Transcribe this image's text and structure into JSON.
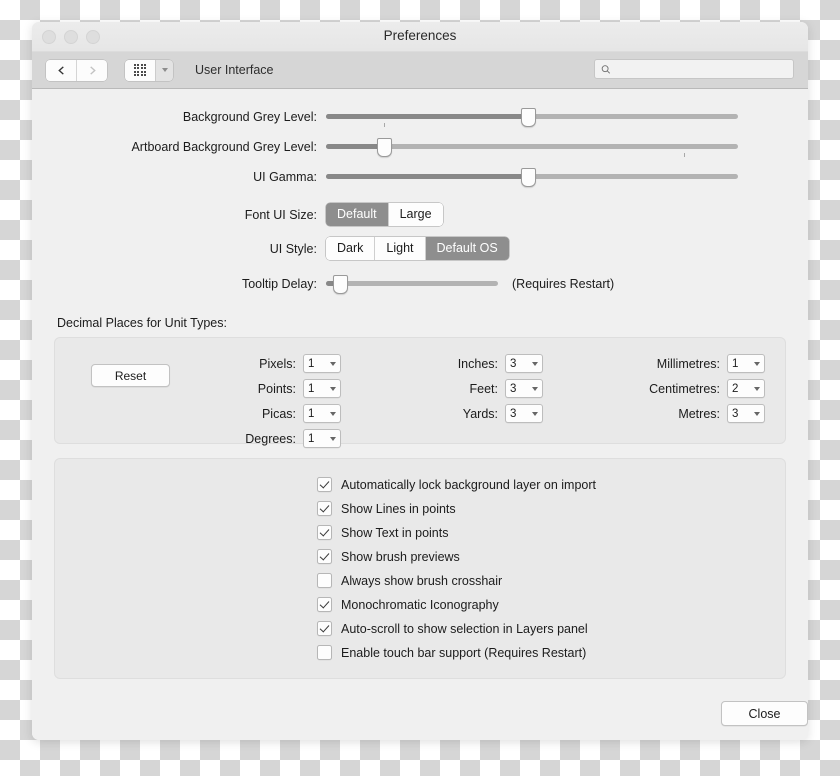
{
  "window": {
    "title": "Preferences",
    "traffic_lights": [
      "close",
      "minimize",
      "zoom"
    ]
  },
  "toolbar": {
    "back_icon": "chevron-left-icon",
    "forward_icon": "chevron-right-icon",
    "grid_icon": "grid-view-icon",
    "dropdown_icon": "chevron-down-icon",
    "page_title": "User Interface",
    "search": {
      "icon": "search-icon",
      "value": "",
      "placeholder": ""
    }
  },
  "sliders": [
    {
      "label": "Background Grey Level:",
      "value_pct": 49,
      "ticks_pct": [
        14,
        49
      ]
    },
    {
      "label": "Artboard Background Grey Level:",
      "value_pct": 14,
      "ticks_pct": [
        14,
        87
      ]
    },
    {
      "label": "UI Gamma:",
      "value_pct": 49,
      "ticks_pct": [
        49
      ]
    }
  ],
  "font_ui_size": {
    "label": "Font UI Size:",
    "options": [
      "Default",
      "Large"
    ],
    "selected": "Default"
  },
  "ui_style": {
    "label": "UI Style:",
    "options": [
      "Dark",
      "Light",
      "Default OS"
    ],
    "selected": "Default OS"
  },
  "tooltip_delay": {
    "label": "Tooltip Delay:",
    "value_pct": 8,
    "ticks_pct": [
      8
    ],
    "note": "(Requires Restart)"
  },
  "decimal_places": {
    "section_label": "Decimal Places for Unit Types:",
    "reset_label": "Reset",
    "columns": [
      [
        {
          "label": "Pixels:",
          "value": "1"
        },
        {
          "label": "Points:",
          "value": "1"
        },
        {
          "label": "Picas:",
          "value": "1"
        },
        {
          "label": "Degrees:",
          "value": "1"
        }
      ],
      [
        {
          "label": "Inches:",
          "value": "3"
        },
        {
          "label": "Feet:",
          "value": "3"
        },
        {
          "label": "Yards:",
          "value": "3"
        }
      ],
      [
        {
          "label": "Millimetres:",
          "value": "1"
        },
        {
          "label": "Centimetres:",
          "value": "2"
        },
        {
          "label": "Metres:",
          "value": "3"
        }
      ]
    ]
  },
  "checkboxes": [
    {
      "label": "Automatically lock background layer on import",
      "checked": true
    },
    {
      "label": "Show Lines in points",
      "checked": true
    },
    {
      "label": "Show Text in points",
      "checked": true
    },
    {
      "label": "Show brush previews",
      "checked": true
    },
    {
      "label": "Always show brush crosshair",
      "checked": false
    },
    {
      "label": "Monochromatic Iconography",
      "checked": true
    },
    {
      "label": "Auto-scroll to show selection in Layers panel",
      "checked": true
    },
    {
      "label": "Enable touch bar support (Requires Restart)",
      "checked": false
    }
  ],
  "footer": {
    "close_label": "Close"
  },
  "colors": {
    "window_bg": "#ececec",
    "content_bg": "#f0f0f0",
    "toolbar_bg": "#d6d6d6",
    "groupbox_bg": "#e9e9e9",
    "selected_segment": "#8e8e8e",
    "slider_fill": "#888888",
    "slider_track": "#b3b3b3"
  }
}
